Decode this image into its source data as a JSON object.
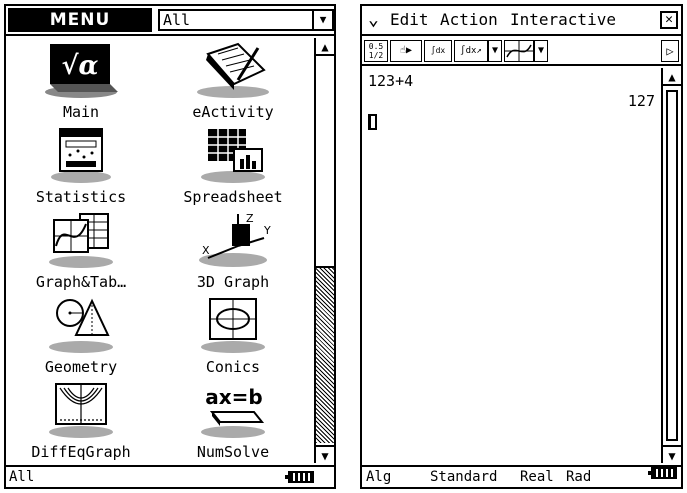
{
  "left": {
    "menu_button": "MENU",
    "category": "All",
    "apps": [
      {
        "label": "Main"
      },
      {
        "label": "eActivity"
      },
      {
        "label": "Statistics"
      },
      {
        "label": "Spreadsheet"
      },
      {
        "label": "Graph&Tab…"
      },
      {
        "label": "3D Graph"
      },
      {
        "label": "Geometry"
      },
      {
        "label": "Conics"
      },
      {
        "label": "DiffEqGraph"
      },
      {
        "label": "NumSolve"
      }
    ],
    "numsolve_glyph": "ax=b",
    "status": "All"
  },
  "right": {
    "menus": {
      "edit": "Edit",
      "action": "Action",
      "interactive": "Interactive"
    },
    "toolbar": {
      "decimal_top": "0.5",
      "decimal_bottom": "1/2"
    },
    "expression": "123+4",
    "result": "127",
    "status": {
      "mode": "Alg",
      "format": "Standard",
      "number": "Real",
      "angle": "Rad"
    }
  }
}
